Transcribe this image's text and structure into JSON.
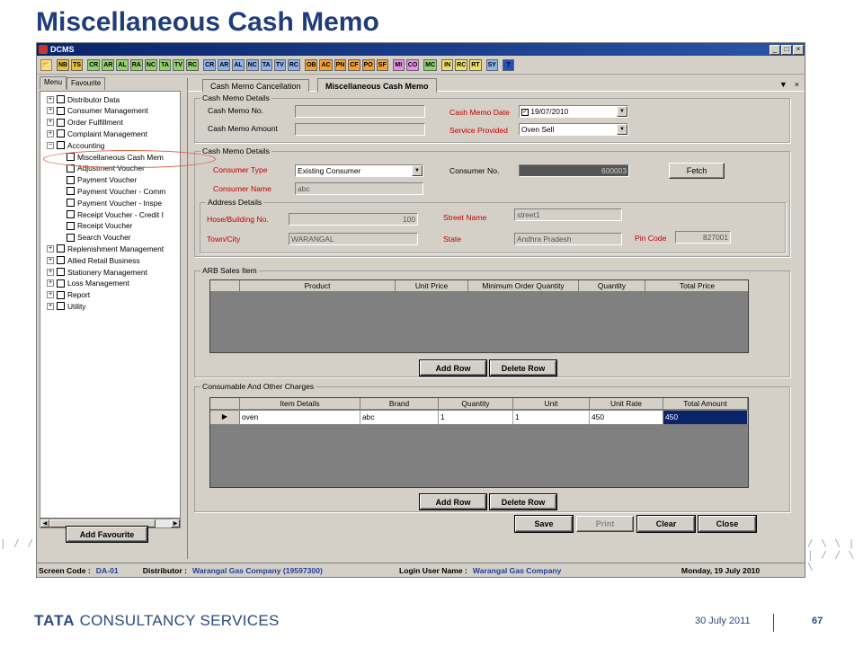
{
  "slide": {
    "title": "Miscellaneous Cash Memo",
    "deco_left": "| / / \\ \\ |",
    "deco_right": "/ \\ \\ | | / / \\ \\",
    "footer_logo_bold": "TATA",
    "footer_logo_rest": "CONSULTANCY SERVICES",
    "footer_date": "30 July 2011",
    "footer_page": "67"
  },
  "window": {
    "title": "DCMS",
    "buttons": [
      "_",
      "□",
      "×"
    ]
  },
  "toolbar": {
    "items": [
      {
        "label": "NB",
        "color": "#e8c030"
      },
      {
        "label": "TS",
        "color": "#e8c030"
      },
      {
        "label": "CR",
        "color": "#8fd36a"
      },
      {
        "label": "AR",
        "color": "#8fd36a"
      },
      {
        "label": "AL",
        "color": "#8fd36a"
      },
      {
        "label": "RA",
        "color": "#8fd36a"
      },
      {
        "label": "NC",
        "color": "#8fd36a"
      },
      {
        "label": "TA",
        "color": "#8fd36a"
      },
      {
        "label": "TV",
        "color": "#8fd36a"
      },
      {
        "label": "RC",
        "color": "#8fd36a"
      },
      {
        "label": "CR",
        "color": "#8fb2f0"
      },
      {
        "label": "AR",
        "color": "#8fb2f0"
      },
      {
        "label": "AL",
        "color": "#8fb2f0"
      },
      {
        "label": "NC",
        "color": "#8fb2f0"
      },
      {
        "label": "TA",
        "color": "#8fb2f0"
      },
      {
        "label": "TV",
        "color": "#8fb2f0"
      },
      {
        "label": "RC",
        "color": "#8fb2f0"
      },
      {
        "label": "OB",
        "color": "#f5a030"
      },
      {
        "label": "AC",
        "color": "#f5a030"
      },
      {
        "label": "PN",
        "color": "#f5a030"
      },
      {
        "label": "CF",
        "color": "#f5a030"
      },
      {
        "label": "PO",
        "color": "#f5a030"
      },
      {
        "label": "SF",
        "color": "#f5a030"
      },
      {
        "label": "MI",
        "color": "#e890e8"
      },
      {
        "label": "CO",
        "color": "#e890e8"
      },
      {
        "label": "MC",
        "color": "#8fd36a"
      },
      {
        "label": "IN",
        "color": "#f0e060"
      },
      {
        "label": "RC",
        "color": "#f0e060"
      },
      {
        "label": "RT",
        "color": "#f0e060"
      },
      {
        "label": "SY",
        "color": "#8fb2f0"
      },
      {
        "label": "?",
        "color": "#2050c0"
      }
    ]
  },
  "left_panel": {
    "tabs": [
      "Menu",
      "Favourite"
    ],
    "tree": [
      {
        "label": "Distributor Data",
        "expander": "+",
        "indent": 0
      },
      {
        "label": "Consumer Management",
        "expander": "+",
        "indent": 0
      },
      {
        "label": "Order Fulfillment",
        "expander": "+",
        "indent": 0
      },
      {
        "label": "Complaint Management",
        "expander": "+",
        "indent": 0
      },
      {
        "label": "Accounting",
        "expander": "−",
        "indent": 0
      },
      {
        "label": "Miscellaneous Cash Mem",
        "expander": "",
        "indent": 1
      },
      {
        "label": "Adjustment Voucher",
        "expander": "",
        "indent": 1
      },
      {
        "label": "Payment Voucher",
        "expander": "",
        "indent": 1
      },
      {
        "label": "Payment Voucher - Comm",
        "expander": "",
        "indent": 1
      },
      {
        "label": "Payment Voucher - Inspe",
        "expander": "",
        "indent": 1
      },
      {
        "label": "Receipt Voucher - Credit I",
        "expander": "",
        "indent": 1
      },
      {
        "label": "Receipt Voucher",
        "expander": "",
        "indent": 1
      },
      {
        "label": "Search Voucher",
        "expander": "",
        "indent": 1
      },
      {
        "label": "Replenishment Management",
        "expander": "+",
        "indent": 0
      },
      {
        "label": "Allied Retail Business",
        "expander": "+",
        "indent": 0
      },
      {
        "label": "Stationery Management",
        "expander": "+",
        "indent": 0
      },
      {
        "label": "Loss Management",
        "expander": "+",
        "indent": 0
      },
      {
        "label": "Report",
        "expander": "+",
        "indent": 0
      },
      {
        "label": "Utility",
        "expander": "+",
        "indent": 0
      }
    ],
    "add_favourite": "Add Favourite"
  },
  "tabs": {
    "items": [
      "Cash Memo Cancellation",
      "Miscellaneous Cash Memo"
    ],
    "controls": [
      "▼",
      "×"
    ]
  },
  "cash_memo_details": {
    "legend": "Cash Memo Details",
    "cash_memo_no_label": "Cash Memo No.",
    "cash_memo_no": "",
    "cash_memo_amount_label": "Cash Memo Amount",
    "cash_memo_amount": "",
    "cash_memo_date_label": "Cash Memo Date",
    "cash_memo_date": "19/07/2010",
    "service_provided_label": "Service Provided",
    "service_provided": "Oven Sell"
  },
  "consumer_details": {
    "legend": "Cash Memo Details",
    "consumer_type_label": "Consumer Type",
    "consumer_type": "Existing Consumer",
    "consumer_no_label": "Consumer No.",
    "consumer_no": "600003",
    "fetch": "Fetch",
    "consumer_name_label": "Consumer Name",
    "consumer_name": "abc",
    "address_legend": "Address Details",
    "hose_label": "Hose/Building No.",
    "hose": "100",
    "street_label": "Street Name",
    "street": "street1",
    "town_label": "Town/City",
    "town": "WARANGAL",
    "state_label": "State",
    "state": "Andhra Pradesh",
    "pin_label": "Pin Code",
    "pin": "827001"
  },
  "arb": {
    "legend": "ARB Sales Item",
    "columns": [
      "Product",
      "Unit Price",
      "Minimum Order Quantity",
      "Quantity",
      "Total Price"
    ],
    "add_row": "Add Row",
    "delete_row": "Delete Row"
  },
  "consumable": {
    "legend": "Consumable And Other Charges",
    "columns": [
      "Item Details",
      "Brand",
      "Quantity",
      "Unit",
      "Unit Rate",
      "Total Amount"
    ],
    "row_marker": "▶",
    "rows": [
      [
        "oven",
        "abc",
        "1",
        "1",
        "450",
        "450"
      ]
    ],
    "add_row": "Add Row",
    "delete_row": "Delete Row"
  },
  "actions": {
    "save": "Save",
    "print": "Print",
    "clear": "Clear",
    "close": "Close"
  },
  "status": {
    "screen_code_label": "Screen Code :",
    "screen_code": "DA-01",
    "distributor_label": "Distributor :",
    "distributor": "Warangal Gas Company (19597300)",
    "login_label": "Login User Name :",
    "login": "Warangal Gas Company",
    "date": "Monday, 19 July 2010"
  }
}
